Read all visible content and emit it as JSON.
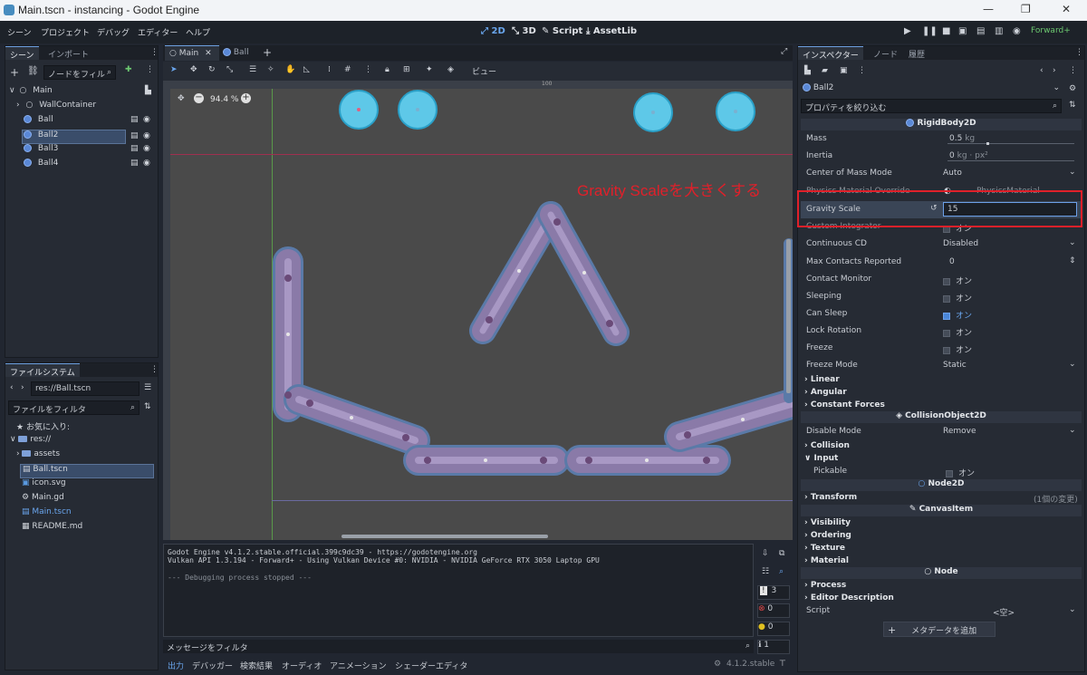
{
  "window": {
    "title": "Main.tscn - instancing - Godot Engine",
    "min": "—",
    "max": "❐",
    "close": "✕"
  },
  "menu": [
    "シーン",
    "プロジェクト",
    "デバッグ",
    "エディター",
    "ヘルプ"
  ],
  "modes": {
    "d2": "2D",
    "d3": "3D",
    "script": "Script",
    "assetlib": "AssetLib"
  },
  "renderer": "Forward+",
  "scene_dock": {
    "tabs": [
      "シーン",
      "インポート"
    ],
    "filter_placeholder": "ノードをフィル",
    "nodes": [
      {
        "label": "Main",
        "icon": "node-circle-icon"
      },
      {
        "label": "WallContainer",
        "icon": "node-circle-icon"
      },
      {
        "label": "Ball",
        "icon": "rigidbody-icon"
      },
      {
        "label": "Ball2",
        "icon": "rigidbody-icon"
      },
      {
        "label": "Ball3",
        "icon": "rigidbody-icon"
      },
      {
        "label": "Ball4",
        "icon": "rigidbody-icon"
      }
    ]
  },
  "fs_dock": {
    "tab": "ファイルシステム",
    "path": "res://Ball.tscn",
    "filter_placeholder": "ファイルをフィルタ",
    "favorites": "お気に入り:",
    "items": [
      "res://",
      "assets",
      "Ball.tscn",
      "icon.svg",
      "Main.gd",
      "Main.tscn",
      "README.md"
    ]
  },
  "editor": {
    "tabs": [
      "Main",
      "Ball"
    ],
    "zoom": "94.4 %",
    "view_label": "ビュー",
    "ruler_100": "100",
    "annotation": "Gravity Scaleを大きくする"
  },
  "console": {
    "lines": [
      "Godot Engine v4.1.2.stable.official.399c9dc39 - https://godotengine.org",
      "Vulkan API 1.3.194 - Forward+ - Using Vulkan Device #0: NVIDIA - NVIDIA GeForce RTX 3050 Laptop GPU",
      "",
      "--- Debugging process stopped ---"
    ],
    "filter_placeholder": "メッセージをフィルタ",
    "counts": [
      "3",
      "0",
      "0",
      "1"
    ]
  },
  "bottom_tabs": [
    "出力",
    "デバッガー",
    "検索結果",
    "オーディオ",
    "アニメーション",
    "シェーダーエディタ"
  ],
  "version": "4.1.2.stable",
  "inspector": {
    "tabs": [
      "インスペクター",
      "ノード",
      "履歴"
    ],
    "object": "Ball2",
    "filter_placeholder": "プロパティを絞り込む",
    "sections": {
      "rigidbody": "RigidBody2D",
      "collision_object": "CollisionObject2D",
      "node2d": "Node2D",
      "canvas_item": "CanvasItem",
      "node": "Node"
    },
    "props": {
      "mass": {
        "label": "Mass",
        "value": "0.5",
        "unit": "kg"
      },
      "inertia": {
        "label": "Inertia",
        "value": "0",
        "unit": "kg · px²"
      },
      "center_of_mass": {
        "label": "Center of Mass Mode",
        "value": "Auto"
      },
      "physics_material": {
        "label": "Physics Material Override",
        "value": "PhysicsMaterial"
      },
      "gravity_scale": {
        "label": "Gravity Scale",
        "value": "15"
      },
      "custom_integrator": {
        "label": "Custom Integrator",
        "value": "オン"
      },
      "continuous_cd": {
        "label": "Continuous CD",
        "value": "Disabled"
      },
      "max_contacts": {
        "label": "Max Contacts Reported",
        "value": "0"
      },
      "contact_monitor": {
        "label": "Contact Monitor",
        "value": "オン"
      },
      "sleeping": {
        "label": "Sleeping",
        "value": "オン"
      },
      "can_sleep": {
        "label": "Can Sleep",
        "value": "オン"
      },
      "lock_rotation": {
        "label": "Lock Rotation",
        "value": "オン"
      },
      "freeze": {
        "label": "Freeze",
        "value": "オン"
      },
      "freeze_mode": {
        "label": "Freeze Mode",
        "value": "Static"
      },
      "disable_mode": {
        "label": "Disable Mode",
        "value": "Remove"
      },
      "pickable": {
        "label": "Pickable",
        "value": "オン"
      },
      "script": {
        "label": "Script",
        "value": "<空>"
      }
    },
    "groups": {
      "linear": "Linear",
      "angular": "Angular",
      "constant_forces": "Constant Forces",
      "collision": "Collision",
      "input": "Input",
      "transform": "Transform",
      "transform_note": "(1個の変更)",
      "visibility": "Visibility",
      "ordering": "Ordering",
      "texture": "Texture",
      "material": "Material",
      "process": "Process",
      "editor_description": "Editor Description"
    },
    "add_metadata": "メタデータを追加"
  },
  "colors": {
    "accent": "#4a86d8",
    "highlight_box": "#e0202a",
    "annotation_text": "#e0202a",
    "ball": "#5ec8e8",
    "wall": "#8a7aa8"
  }
}
